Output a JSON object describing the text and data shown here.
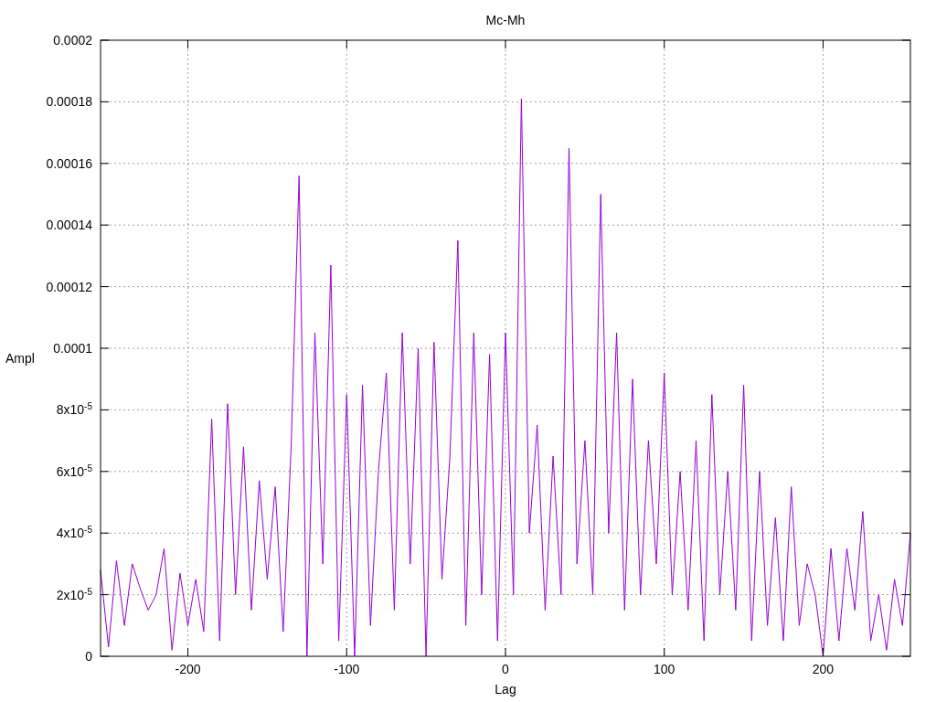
{
  "chart_data": {
    "type": "line",
    "title": "Mc-Mh",
    "xlabel": "Lag",
    "ylabel": "Ampl",
    "grid": true,
    "xlim": [
      -255,
      255
    ],
    "ylim": [
      0,
      0.0002
    ],
    "xticks": [
      -200,
      -100,
      0,
      100,
      200
    ],
    "yticks": [
      {
        "value": 0,
        "label": "0"
      },
      {
        "value": 2e-05,
        "label": "2x10$^{-5}$"
      },
      {
        "value": 4e-05,
        "label": "4x10$^{-5}$"
      },
      {
        "value": 6e-05,
        "label": "6x10$^{-5}$"
      },
      {
        "value": 8e-05,
        "label": "8x10$^{-5}$"
      },
      {
        "value": 0.0001,
        "label": "0.0001"
      },
      {
        "value": 0.00012,
        "label": "0.00012"
      },
      {
        "value": 0.00014,
        "label": "0.00014"
      },
      {
        "value": 0.00016,
        "label": "0.00016"
      },
      {
        "value": 0.00018,
        "label": "0.00018"
      },
      {
        "value": 0.0002,
        "label": "0.0002"
      }
    ],
    "x": [
      -255,
      -250,
      -245,
      -240,
      -235,
      -230,
      -225,
      -220,
      -215,
      -210,
      -205,
      -200,
      -195,
      -190,
      -185,
      -180,
      -175,
      -170,
      -165,
      -160,
      -155,
      -150,
      -145,
      -140,
      -135,
      -130,
      -125,
      -120,
      -115,
      -110,
      -105,
      -100,
      -95,
      -90,
      -85,
      -80,
      -75,
      -70,
      -65,
      -60,
      -55,
      -50,
      -45,
      -40,
      -35,
      -30,
      -25,
      -20,
      -15,
      -10,
      -5,
      0,
      5,
      10,
      15,
      20,
      25,
      30,
      35,
      40,
      45,
      50,
      55,
      60,
      65,
      70,
      75,
      80,
      85,
      90,
      95,
      100,
      105,
      110,
      115,
      120,
      125,
      130,
      135,
      140,
      145,
      150,
      155,
      160,
      165,
      170,
      175,
      180,
      185,
      190,
      195,
      200,
      205,
      210,
      215,
      220,
      225,
      230,
      235,
      240,
      245,
      250,
      255
    ],
    "series": [
      {
        "color": "#9400d3",
        "values": [
          2.8e-05,
          3e-06,
          3.1e-05,
          1e-05,
          3e-05,
          2.2e-05,
          1.5e-05,
          2e-05,
          3.5e-05,
          2e-06,
          2.7e-05,
          1e-05,
          2.5e-05,
          8e-06,
          7.7e-05,
          5e-06,
          8.2e-05,
          2e-05,
          6.8e-05,
          1.5e-05,
          5.7e-05,
          2.5e-05,
          5.5e-05,
          8e-06,
          6.8e-05,
          0.000156,
          0,
          0.000105,
          3e-05,
          0.000127,
          5e-06,
          8.5e-05,
          0,
          8.8e-05,
          1e-05,
          6e-05,
          9.2e-05,
          1.5e-05,
          0.000105,
          3e-05,
          0.0001,
          0,
          0.000102,
          2.5e-05,
          6.5e-05,
          0.000135,
          1e-05,
          0.000105,
          2e-05,
          9.8e-05,
          5e-06,
          0.000105,
          2e-05,
          0.000181,
          4e-05,
          7.5e-05,
          1.5e-05,
          6.5e-05,
          2e-05,
          0.000165,
          3e-05,
          7e-05,
          2e-05,
          0.00015,
          4e-05,
          0.000105,
          1.5e-05,
          9e-05,
          2e-05,
          7e-05,
          3e-05,
          9.2e-05,
          2e-05,
          6e-05,
          1.5e-05,
          7e-05,
          5e-06,
          8.5e-05,
          2e-05,
          6e-05,
          1.5e-05,
          8.8e-05,
          5e-06,
          6e-05,
          1e-05,
          4.5e-05,
          5e-06,
          5.5e-05,
          1e-05,
          3e-05,
          2e-05,
          0,
          3.5e-05,
          5e-06,
          3.5e-05,
          1.5e-05,
          4.7e-05,
          5e-06,
          2e-05,
          2e-06,
          2.5e-05,
          1e-05,
          4e-05
        ]
      }
    ]
  }
}
